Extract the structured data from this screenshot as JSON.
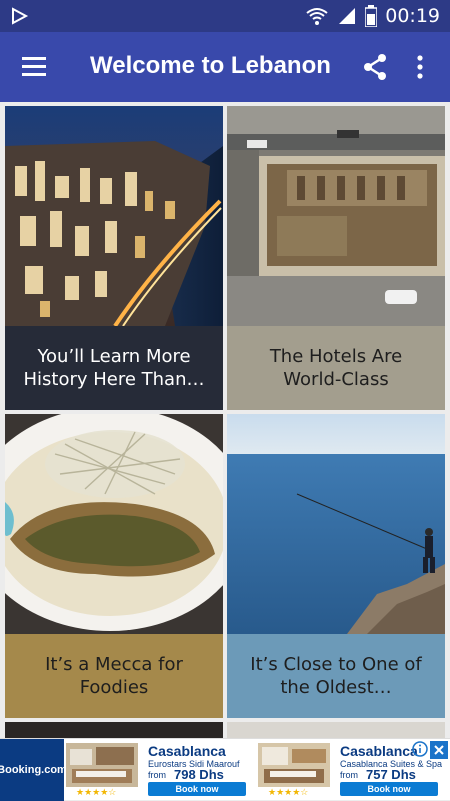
{
  "status_bar": {
    "time": "00:19"
  },
  "app_bar": {
    "title": "Welcome to Lebanon"
  },
  "cards": [
    {
      "caption": "You’ll Learn More History Here Than…",
      "caption_bg": "#262b38",
      "caption_color": "#ffffff",
      "image": "city-night"
    },
    {
      "caption": "The Hotels Are World-Class",
      "caption_bg": "#a39e8e",
      "caption_color": "#1e1e1e",
      "image": "roman-ruins"
    },
    {
      "caption": "It’s a Mecca for Foodies",
      "caption_bg": "#a5894b",
      "caption_color": "#1e1e1e",
      "image": "fish-dish"
    },
    {
      "caption": "It’s Close to One of the Oldest…",
      "caption_bg": "#6c9ab8",
      "caption_color": "#1e1e1e",
      "image": "sea-fisherman"
    }
  ],
  "ad": {
    "brand": "Booking.com",
    "units": [
      {
        "hotel": "Casablanca",
        "subtitle": "Eurostars Sidi Maarouf",
        "from": "from",
        "price": "798 Dhs",
        "button": "Book now",
        "stars": "★★★★☆"
      },
      {
        "hotel": "Casablanca",
        "subtitle": "Casablanca Suites & Spa",
        "from": "from",
        "price": "757 Dhs",
        "button": "Book now",
        "stars": "★★★★☆"
      }
    ]
  }
}
